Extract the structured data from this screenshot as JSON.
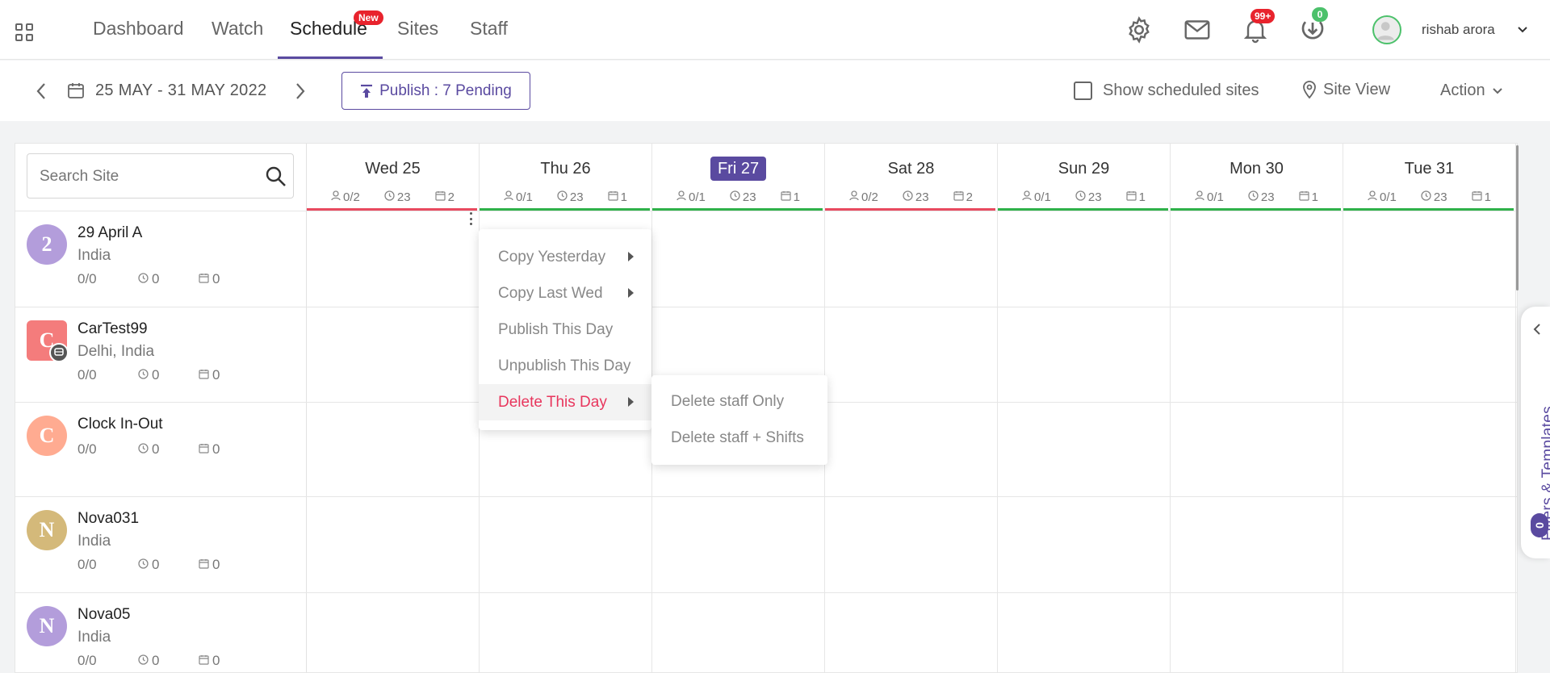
{
  "nav": {
    "items": [
      "Dashboard",
      "Watch",
      "Schedule",
      "Sites",
      "Staff"
    ],
    "new_badge": "New",
    "notifications_badge": "99+",
    "downloads_badge": "0",
    "user_name": "rishab arora"
  },
  "toolbar": {
    "date_range": "25 MAY - 31 MAY 2022",
    "publish_label": "Publish : 7 Pending",
    "show_scheduled_label": "Show scheduled sites",
    "site_view_label": "Site View",
    "action_label": "Action"
  },
  "search": {
    "placeholder": "Search Site"
  },
  "days": [
    {
      "label": "Wed 25",
      "staff": "0/2",
      "hours": "23",
      "shifts": "2",
      "status_color": "#e84a5f",
      "today": false
    },
    {
      "label": "Thu 26",
      "staff": "0/1",
      "hours": "23",
      "shifts": "1",
      "status_color": "#2fb14a",
      "today": false
    },
    {
      "label": "Fri 27",
      "staff": "0/1",
      "hours": "23",
      "shifts": "1",
      "status_color": "#2fb14a",
      "today": true
    },
    {
      "label": "Sat 28",
      "staff": "0/2",
      "hours": "23",
      "shifts": "2",
      "status_color": "#e84a5f",
      "today": false
    },
    {
      "label": "Sun 29",
      "staff": "0/1",
      "hours": "23",
      "shifts": "1",
      "status_color": "#2fb14a",
      "today": false
    },
    {
      "label": "Mon 30",
      "staff": "0/1",
      "hours": "23",
      "shifts": "1",
      "status_color": "#2fb14a",
      "today": false
    },
    {
      "label": "Tue 31",
      "staff": "0/1",
      "hours": "23",
      "shifts": "1",
      "status_color": "#2fb14a",
      "today": false
    }
  ],
  "sites": [
    {
      "initial": "2",
      "name": "29 April A",
      "location": "India",
      "staff": "0/0",
      "hours": "0",
      "shifts": "0",
      "color": "#b39ddb",
      "shape": "circle"
    },
    {
      "initial": "C",
      "name": "CarTest99",
      "location": "Delhi, India",
      "staff": "0/0",
      "hours": "0",
      "shifts": "0",
      "color": "#f47c7c",
      "shape": "square"
    },
    {
      "initial": "C",
      "name": "Clock In-Out",
      "location": "",
      "staff": "0/0",
      "hours": "0",
      "shifts": "0",
      "color": "#ffab91",
      "shape": "circle"
    },
    {
      "initial": "N",
      "name": "Nova031",
      "location": "India",
      "staff": "0/0",
      "hours": "0",
      "shifts": "0",
      "color": "#d4b97a",
      "shape": "circle"
    },
    {
      "initial": "N",
      "name": "Nova05",
      "location": "India",
      "staff": "0/0",
      "hours": "0",
      "shifts": "0",
      "color": "#b39ddb",
      "shape": "circle"
    }
  ],
  "context_menu": {
    "items": [
      "Copy Yesterday",
      "Copy Last Wed",
      "Publish This Day",
      "Unpublish This Day",
      "Delete This Day"
    ],
    "submenu": [
      "Delete staff Only",
      "Delete staff + Shifts"
    ]
  },
  "side_panel": {
    "label": "Filters & Templates",
    "count": "0"
  },
  "colors": {
    "accent": "#5a4aa0",
    "danger": "#e84a5f",
    "success": "#2fb14a"
  }
}
